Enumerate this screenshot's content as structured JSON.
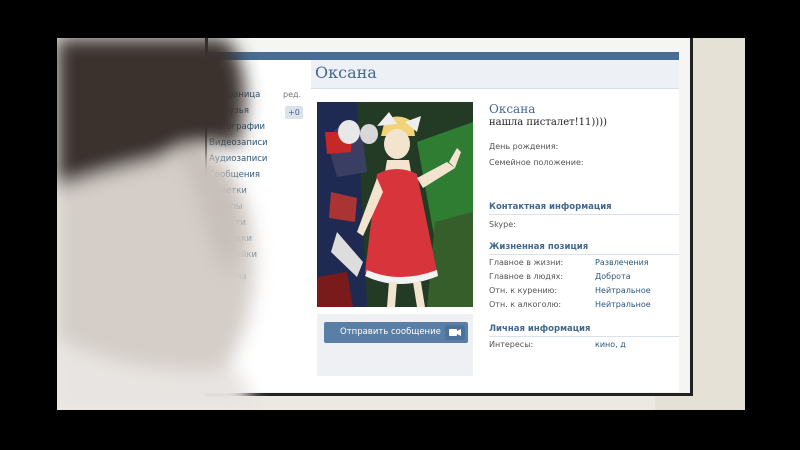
{
  "sidebar": {
    "edit_label": "ред.",
    "friends_badge": "+0",
    "items": [
      {
        "label": "я Страница"
      },
      {
        "label": "и Друзья"
      },
      {
        "label": "Фотографии"
      },
      {
        "label": "Видеозаписи"
      },
      {
        "label": "Аудиозаписи"
      },
      {
        "label": "Сообщения"
      },
      {
        "label": "Заметки"
      },
      {
        "label": "Группы"
      },
      {
        "label": "Новости"
      },
      {
        "label": "Закладки"
      },
      {
        "label": "Настройки"
      },
      {
        "label": "Реклама"
      }
    ]
  },
  "header": {
    "title": "Оксана"
  },
  "actions": {
    "send_message": "Отправить сообщение"
  },
  "profile": {
    "name": "Оксана",
    "status": "нашла писталет!11))))",
    "birthday_label": "День рождения:",
    "family_label": "Семейное положение:",
    "contact_title": "Контактная информация",
    "skype_label": "Skype:",
    "life_title": "Жизненная позиция",
    "life_main_label": "Главное в жизни:",
    "life_main_value": "Развлечения",
    "people_label": "Главное в людях:",
    "people_value": "Доброта",
    "smoking_label": "Отн. к курению:",
    "smoking_value": "Нейтральное",
    "alcohol_label": "Отн. к алкоголю:",
    "alcohol_value": "Нейтральное",
    "personal_title": "Личная информация",
    "interests_label": "Интересы:",
    "interests_value": "кино, д"
  },
  "colors": {
    "vk_blue": "#45688e",
    "link": "#2b587a",
    "button": "#5a7fa6",
    "dress_red": "#d8343c"
  }
}
